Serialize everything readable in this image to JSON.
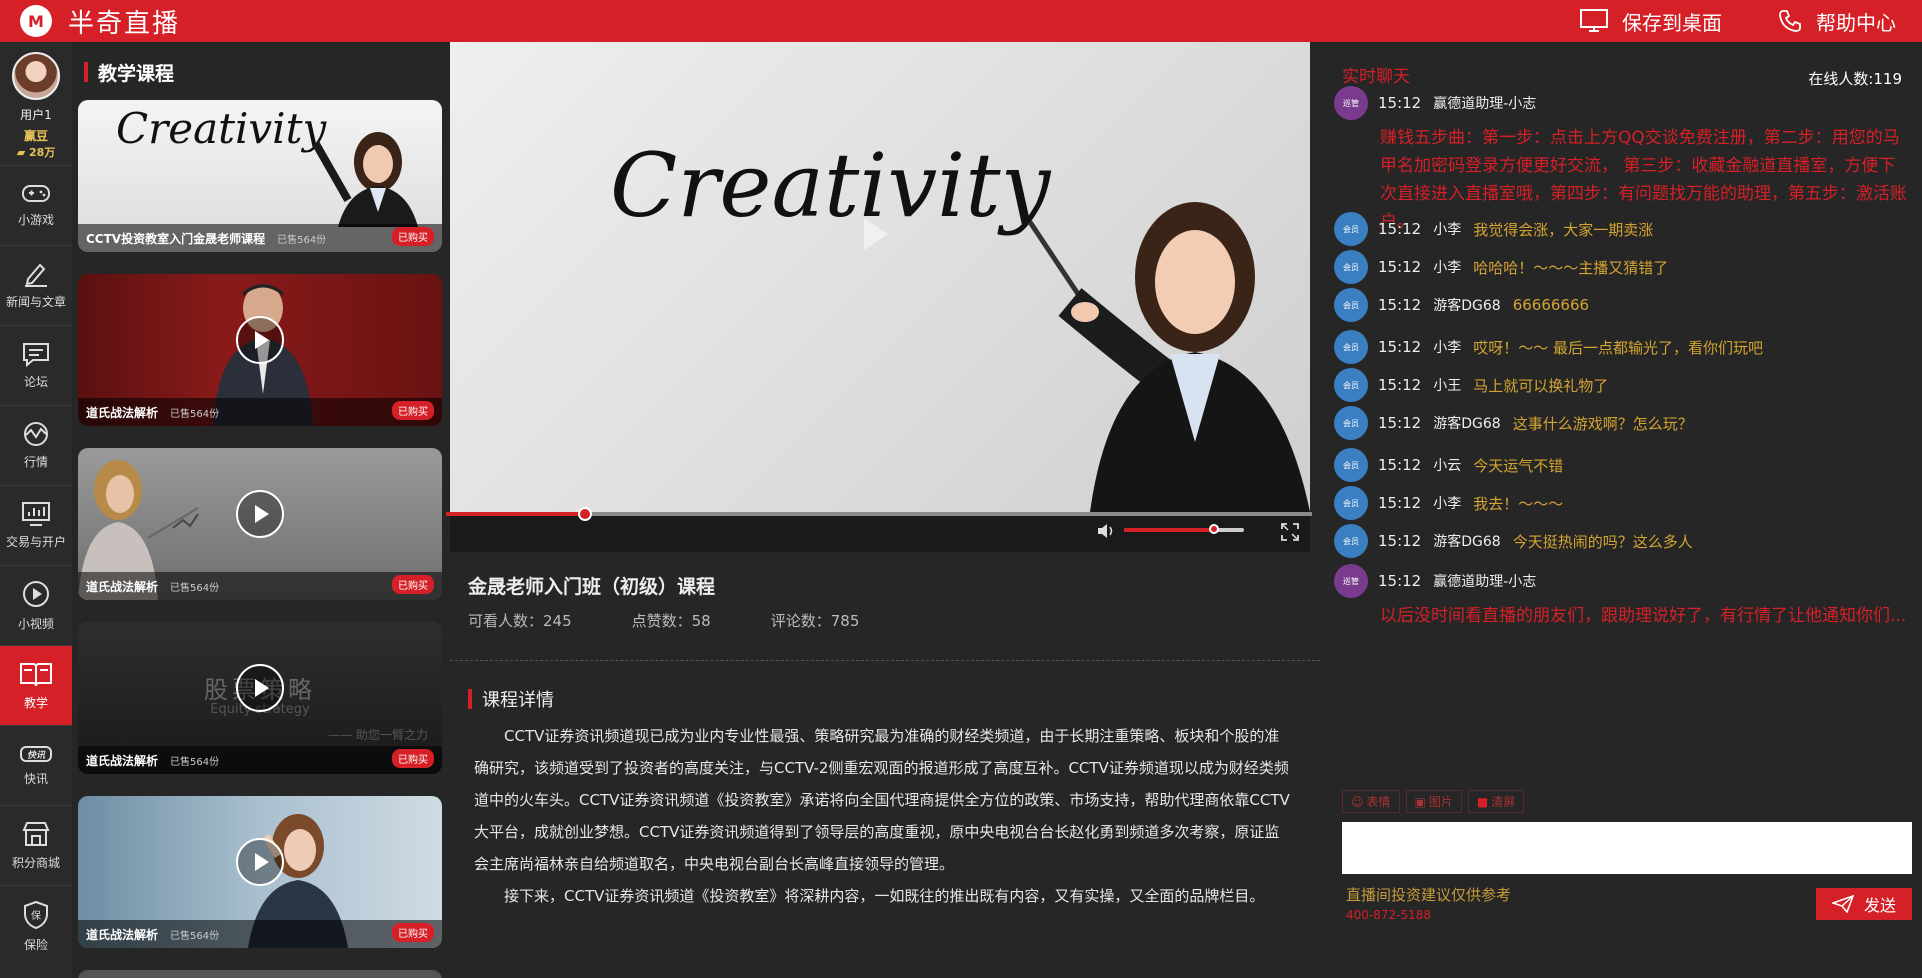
{
  "app": {
    "title": "半奇直播",
    "logo_letter": "M"
  },
  "topbar": {
    "save_desktop": "保存到桌面",
    "help_center": "帮助中心"
  },
  "user": {
    "name": "用户1",
    "level": "赢豆",
    "coins": "28万"
  },
  "nav": [
    {
      "label": "小游戏",
      "icon": "gamepad-icon"
    },
    {
      "label": "新闻与文章",
      "icon": "pen-icon"
    },
    {
      "label": "论坛",
      "icon": "chat-bubble-icon"
    },
    {
      "label": "行情",
      "icon": "wave-icon"
    },
    {
      "label": "交易与开户",
      "icon": "monitor-chart-icon"
    },
    {
      "label": "小视频",
      "icon": "play-circle-icon"
    },
    {
      "label": "教学",
      "icon": "book-icon",
      "active": true
    },
    {
      "label": "快讯",
      "icon": "news-flash-icon"
    },
    {
      "label": "积分商城",
      "icon": "shop-icon"
    },
    {
      "label": "保险",
      "icon": "shield-icon"
    }
  ],
  "courses": {
    "title": "教学课程",
    "items": [
      {
        "name": "CCTV投资教室入门金晟老师课程",
        "sold": "已售564份",
        "badge": "已购买",
        "cover_text": "Creativity"
      },
      {
        "name": "道氏战法解析",
        "sold": "已售564份",
        "badge": "已购买"
      },
      {
        "name": "道氏战法解析",
        "sold": "已售564份",
        "badge": "已购买"
      },
      {
        "name": "道氏战法解析",
        "sold": "已售564份",
        "badge": "已购买",
        "cover_title": "股票策略",
        "cover_sub": "Equity strategy",
        "cover_note": "—— 助您一臂之力"
      },
      {
        "name": "道氏战法解析",
        "sold": "已售564份",
        "badge": "已购买"
      }
    ]
  },
  "video": {
    "board_text": "Creativity",
    "progress": 0.16,
    "volume": 0.75
  },
  "course_info": {
    "title": "金晟老师入门班（初级）课程",
    "viewers": "可看人数：245",
    "likes": "点赞数：58",
    "comments": "评论数：785",
    "detail_title": "课程详情",
    "para1": "CCTV证券资讯频道现已成为业内专业性最强、策略研究最为准确的财经类频道，由于长期注重策略、板块和个股的准确研究，该频道受到了投资者的高度关注，与CCTV-2侧重宏观面的报道形成了高度互补。CCTV证券频道现以成为财经类频道中的火车头。CCTV证券资讯频道《投资教室》承诺将向全国代理商提供全方位的政策、市场支持，帮助代理商依靠CCTV大平台，成就创业梦想。CCTV证券资讯频道得到了领导层的高度重视，原中央电视台台长赵化勇到频道多次考察，原证监会主席尚福林亲自给频道取名，中央电视台副台长高峰直接领导的管理。",
    "para2": "接下来，CCTV证券资讯频道《投资教室》将深耕内容，一如既往的推出既有内容，又有实操，又全面的品牌栏目。"
  },
  "chat": {
    "title": "实时聊天",
    "online": "在线人数:119",
    "messages": [
      {
        "type": "admin",
        "badge": "巡管",
        "time": "15:12",
        "user": "赢德道助理-小志",
        "text": "赚钱五步曲：第一步：点击上方QQ交谈免费注册，第二步：用您的马甲名加密码登录方便更好交流， 第三步：收藏金融道直播室，方便下次直接进入直播室哦，第四步：有问题找万能的助理，第五步：激活账户。"
      },
      {
        "type": "vip",
        "badge": "会员",
        "time": "15:12",
        "user": "小李",
        "text": "我觉得会涨，大家一期卖涨"
      },
      {
        "type": "vip",
        "badge": "会员",
        "time": "15:12",
        "user": "小李",
        "text": "哈哈哈！～～～主播又猜错了"
      },
      {
        "type": "vip",
        "badge": "会员",
        "time": "15:12",
        "user": "游客DG68",
        "text": "66666666"
      },
      {
        "type": "vip",
        "badge": "会员",
        "time": "15:12",
        "user": "小李",
        "text": "哎呀！～～ 最后一点都输光了，看你们玩吧"
      },
      {
        "type": "vip",
        "badge": "会员",
        "time": "15:12",
        "user": "小王",
        "text": "马上就可以换礼物了"
      },
      {
        "type": "vip",
        "badge": "会员",
        "time": "15:12",
        "user": "游客DG68",
        "text": "这事什么游戏啊？怎么玩？"
      },
      {
        "type": "vip",
        "badge": "会员",
        "time": "15:12",
        "user": "小云",
        "text": "今天运气不错"
      },
      {
        "type": "vip",
        "badge": "会员",
        "time": "15:12",
        "user": "小李",
        "text": "我去！～～～"
      },
      {
        "type": "vip",
        "badge": "会员",
        "time": "15:12",
        "user": "游客DG68",
        "text": "今天挺热闹的吗？这么多人"
      },
      {
        "type": "admin",
        "badge": "巡管",
        "time": "15:12",
        "user": "赢德道助理-小志",
        "text": "以后没时间看直播的朋友们，跟助理说好了，有行情了让他通知你们..."
      }
    ],
    "tool_emoji": "表情",
    "tool_image": "图片",
    "tool_clear": "清屏",
    "input_placeholder": "",
    "disclaimer": "直播间投资建议仅供参考",
    "phone": "400-872-5188",
    "send": "发送"
  },
  "colors": {
    "brand_red": "#d42026",
    "gold": "#d4a431",
    "vip_blue": "#3a7fc1",
    "admin_purple": "#7a3b8e"
  }
}
